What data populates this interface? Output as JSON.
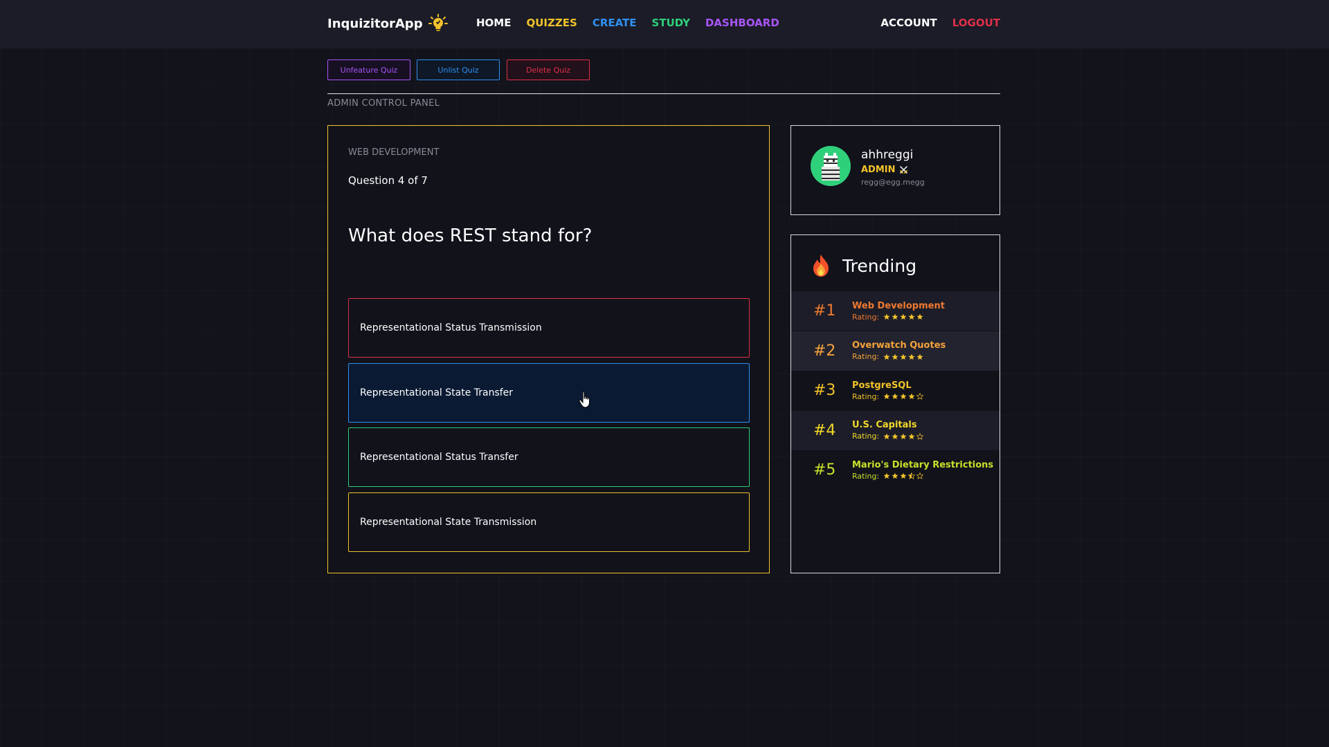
{
  "nav": {
    "brand": "InquizitorApp",
    "links": [
      {
        "label": "HOME",
        "color": "#ffffff"
      },
      {
        "label": "QUIZZES",
        "color": "#f2c32b"
      },
      {
        "label": "CREATE",
        "color": "#2f8ff0"
      },
      {
        "label": "STUDY",
        "color": "#2fd07a"
      },
      {
        "label": "DASHBOARD",
        "color": "#a855f7"
      }
    ],
    "account": "ACCOUNT",
    "logout": "LOGOUT"
  },
  "admin": {
    "unfeature": "Unfeature Quiz",
    "unlist": "Unlist Quiz",
    "delete": "Delete Quiz",
    "panel_label": "ADMIN CONTROL PANEL"
  },
  "quiz": {
    "category": "WEB DEVELOPMENT",
    "counter": "Question 4 of 7",
    "question": "What does REST stand for?",
    "answers": [
      {
        "text": "Representational Status Transmission",
        "color": "#e0304a"
      },
      {
        "text": "Representational State Transfer",
        "color": "#2f8ff0"
      },
      {
        "text": "Representational Status Transfer",
        "color": "#2fd07a"
      },
      {
        "text": "Representational State Transmission",
        "color": "#f2c32b"
      }
    ]
  },
  "profile": {
    "username": "ahhreggi",
    "role": "ADMIN",
    "email": "regg@egg.megg"
  },
  "trending": {
    "title": "Trending",
    "rating_label": "Rating:",
    "items": [
      {
        "rank": "#1",
        "name": "Web Development",
        "rating": 5,
        "color": "#f07a2f"
      },
      {
        "rank": "#2",
        "name": "Overwatch Quotes",
        "rating": 5,
        "color": "#f5a23a"
      },
      {
        "rank": "#3",
        "name": "PostgreSQL",
        "rating": 4,
        "color": "#f2c32b"
      },
      {
        "rank": "#4",
        "name": "U.S. Capitals",
        "rating": 4,
        "color": "#f2d82b"
      },
      {
        "rank": "#5",
        "name": "Mario's Dietary Restrictions",
        "rating": 3.5,
        "color": "#c8e02b"
      }
    ]
  },
  "colors": {
    "accent": "#f2c32b",
    "purple": "#a855f7",
    "blue": "#2f8ff0",
    "red": "#e0304a",
    "green": "#2fd07a"
  }
}
